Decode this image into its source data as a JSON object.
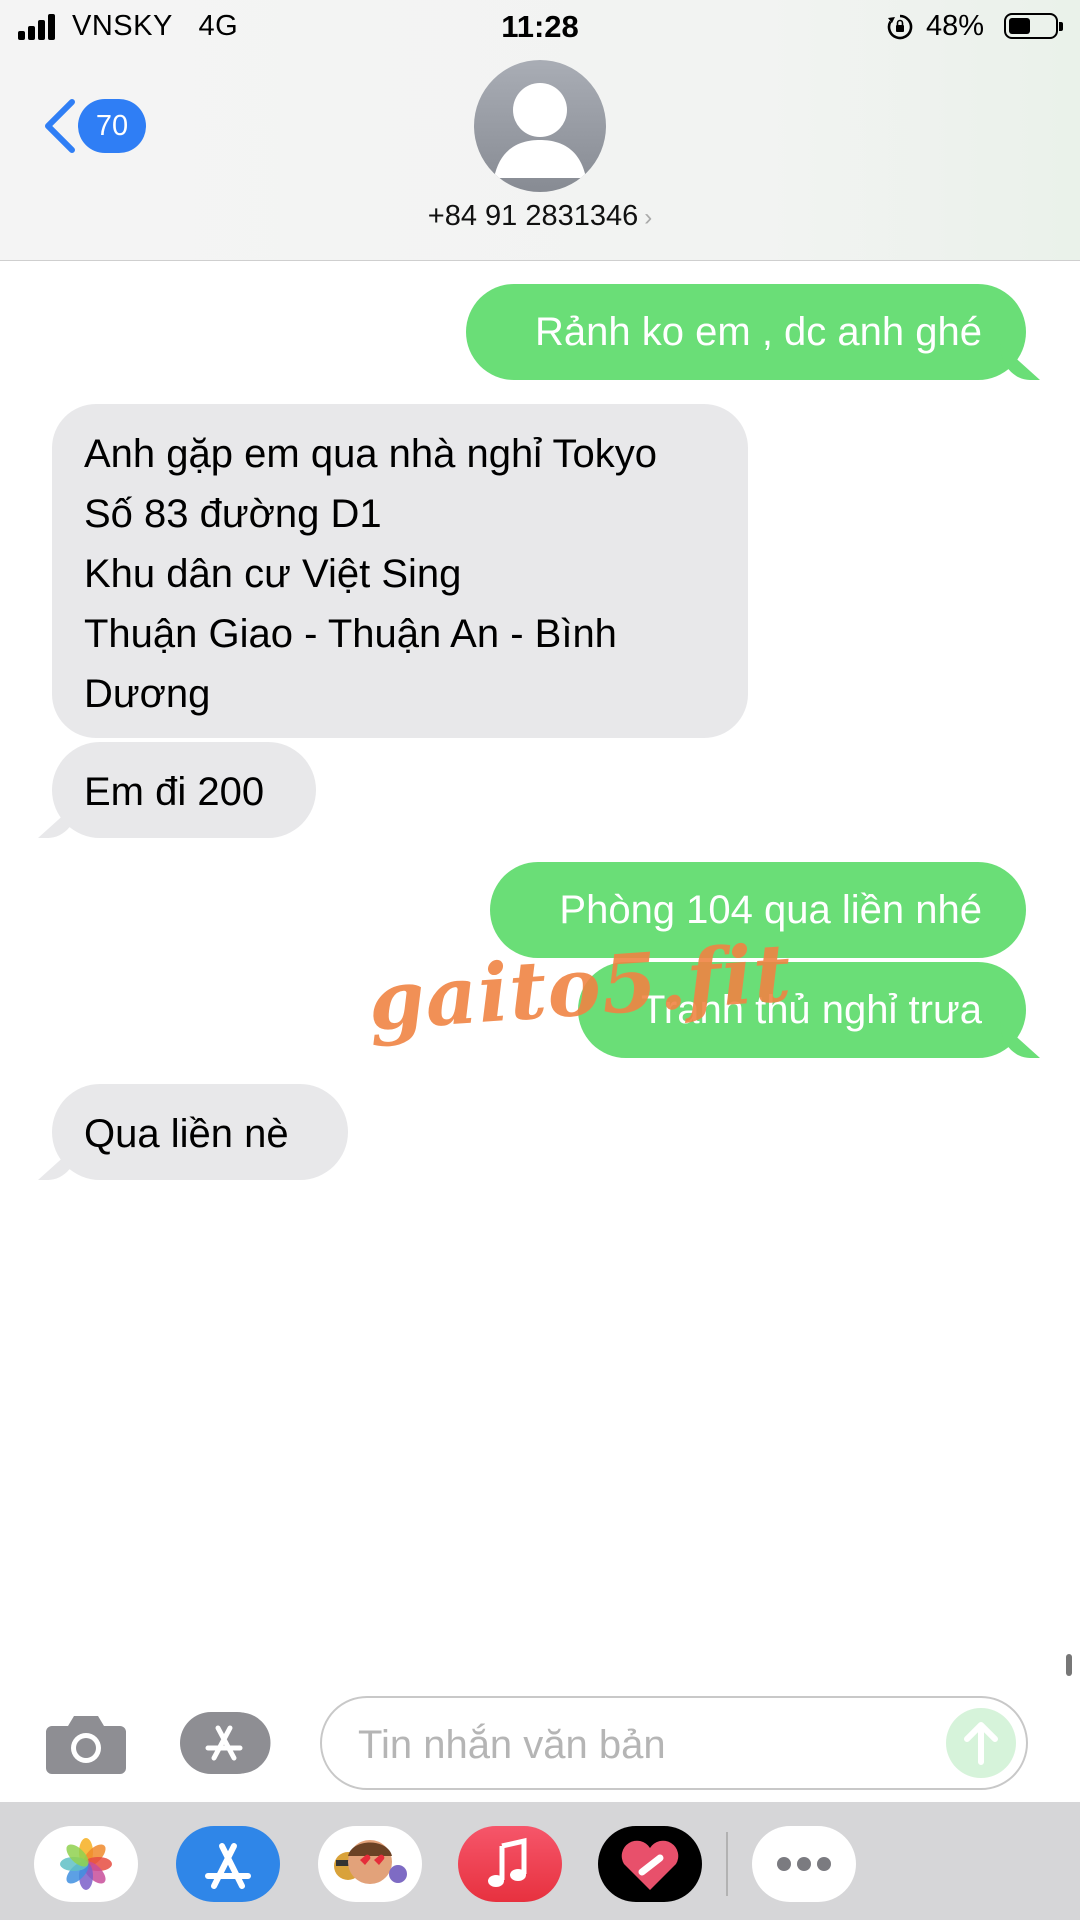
{
  "status_bar": {
    "carrier": "VNSKY",
    "network": "4G",
    "time": "11:28",
    "battery_percent": "48%",
    "battery_level": 0.48
  },
  "header": {
    "unread_count": "70",
    "contact_number": "+84 91 2831346",
    "contact_chevron": "›"
  },
  "messages": [
    {
      "direction": "outgoing",
      "lines": [
        "Rảnh ko em , dc anh ghé"
      ]
    },
    {
      "direction": "incoming",
      "lines": [
        "Anh gặp em qua nhà nghỉ Tokyo",
        "Số 83 đường D1",
        "Khu dân cư Việt Sing",
        "Thuận Giao - Thuận An - Bình",
        "Dương"
      ]
    },
    {
      "direction": "incoming",
      "lines": [
        "Em đi 200"
      ]
    },
    {
      "direction": "outgoing",
      "lines": [
        "Phòng 104 qua liền nhé"
      ]
    },
    {
      "direction": "outgoing",
      "lines": [
        "Tranh thủ nghỉ trưa"
      ]
    },
    {
      "direction": "incoming",
      "lines": [
        "Qua liền nè"
      ]
    }
  ],
  "watermark": "gaito5.fit",
  "composer": {
    "placeholder": "Tin nhắn văn bản",
    "value": ""
  },
  "icons": {
    "back": "chevron-left-icon",
    "camera": "camera-icon",
    "appstore": "appstore-icon",
    "send": "arrow-up-icon",
    "drawer": [
      "photos-icon",
      "appstore-icon",
      "memoji-icon",
      "music-icon",
      "digital-touch-icon",
      "more-icon"
    ]
  },
  "colors": {
    "outgoing_bubble": "#6ade77",
    "incoming_bubble": "#e8e8ea",
    "badge": "#2f7ef5",
    "watermark": "#f08444"
  }
}
